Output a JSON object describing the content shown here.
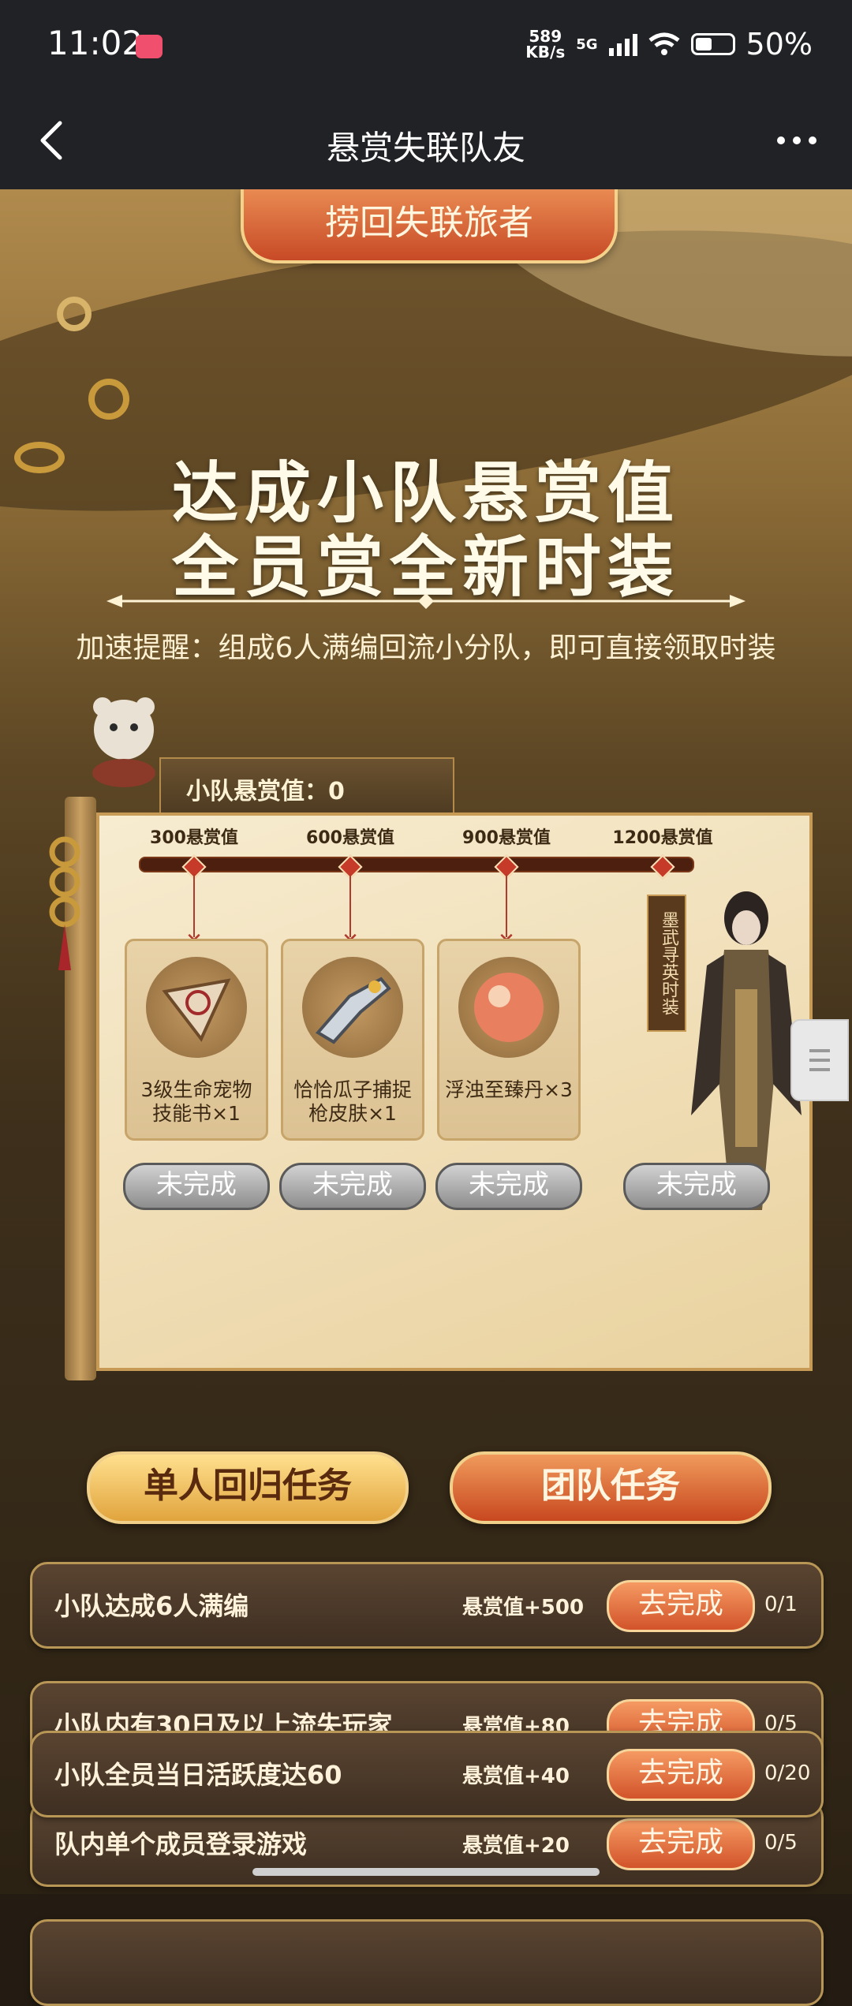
{
  "status": {
    "time": "11:02",
    "net_speed_top": "589",
    "net_speed_unit": "KB/s",
    "network": "5G",
    "battery": "50%"
  },
  "nav": {
    "title": "悬赏失联队友"
  },
  "banner": {
    "top_label": "捞回失联旅者",
    "headline_line1": "达成小队悬赏值",
    "headline_line2": "全员赏全新时装",
    "tip": "加速提醒：组成6人满编回流小分队，即可直接领取时装"
  },
  "panel": {
    "score_label": "小队悬赏值：0",
    "milestones": [
      {
        "label": "300悬赏值"
      },
      {
        "label": "600悬赏值"
      },
      {
        "label": "900悬赏值"
      },
      {
        "label": "1200悬赏值"
      }
    ],
    "rewards": [
      {
        "name": "3级生命宠物技能书×1",
        "status": "未完成"
      },
      {
        "name": "恰恰瓜子捕捉枪皮肤×1",
        "status": "未完成"
      },
      {
        "name": "浮浊至臻丹×3",
        "status": "未完成"
      },
      {
        "name": "墨武寻英时装",
        "status": "未完成"
      }
    ]
  },
  "tabs": {
    "single": "单人回归任务",
    "team": "团队任务"
  },
  "tasks": [
    {
      "name": "小队达成6人满编",
      "reward": "悬赏值+500",
      "action": "去完成",
      "progress": "0/1"
    },
    {
      "name": "小队内有30日及以上流失玩家",
      "reward": "悬赏值+80",
      "action": "去完成",
      "progress": "0/5"
    },
    {
      "name": "队内单个成员登录游戏",
      "reward": "悬赏值+20",
      "action": "去完成",
      "progress": "0/5"
    },
    {
      "name": "小队全员当日活跃度达60",
      "reward": "悬赏值+40",
      "action": "去完成",
      "progress": "0/20"
    }
  ],
  "colors": {
    "accent_orange": "#d2532a",
    "gold": "#f0d08a",
    "dark_bar": "#202225"
  }
}
